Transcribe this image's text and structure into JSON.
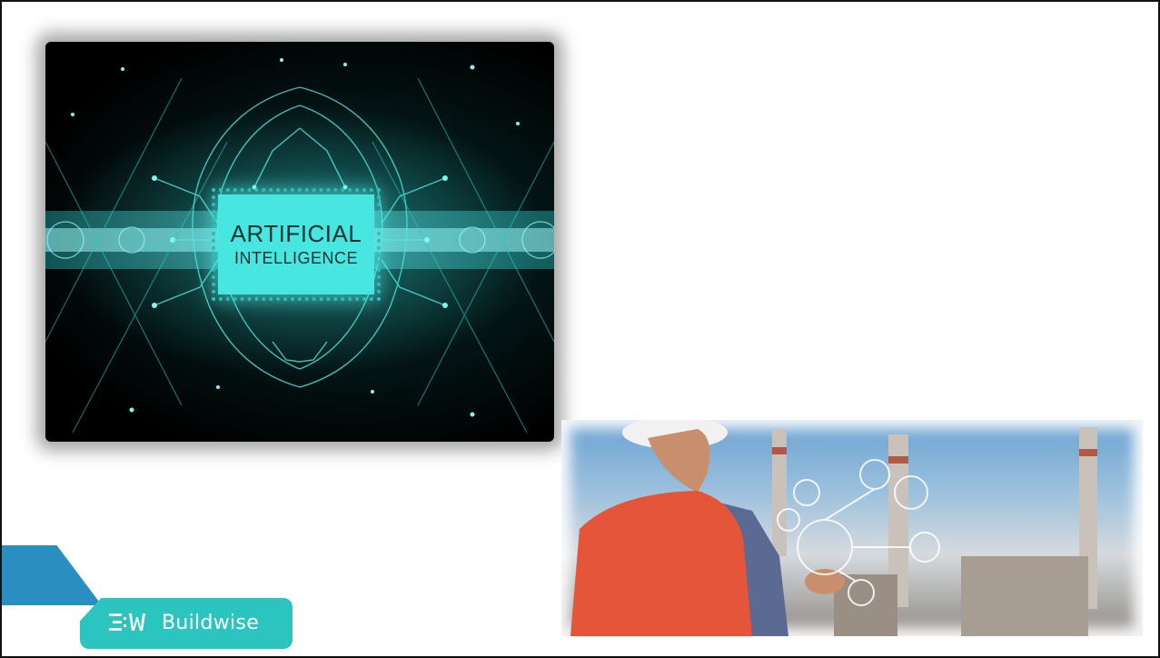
{
  "ai_picture": {
    "chip_line1": "ARTIFICIAL",
    "chip_line2": "INTELLIGENCE"
  },
  "engineer_picture": {
    "subject": "engineer-with-tablet-image"
  },
  "logo": {
    "brand_text": "Buildwise",
    "mark_icon": "buildwise-logo-mark-icon"
  },
  "colors": {
    "accent_teal": "#2cc4be",
    "accent_blue": "#2a8fc0",
    "chip_cyan": "#47e6e0"
  }
}
